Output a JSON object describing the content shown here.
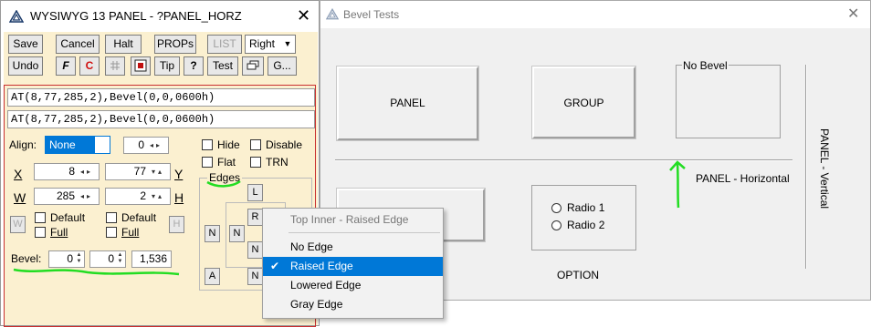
{
  "panel_window": {
    "title": "WYSIWYG 13 PANEL - ?PANEL_HORZ",
    "toolbar_row1": {
      "save": "Save",
      "cancel": "Cancel",
      "halt": "Halt",
      "props": "PROPs",
      "list": "LIST",
      "align_select": "Right"
    },
    "toolbar_row2": {
      "undo": "Undo",
      "font_btn": "F",
      "color_btn": "C",
      "tip": "Tip",
      "help": "?",
      "test": "Test",
      "more": "G..."
    },
    "code_lines": [
      "AT(8,77,285,2),Bevel(0,0,0600h)",
      "AT(8,77,285,2),Bevel(0,0,0600h)"
    ],
    "align_label": "Align:",
    "align_value": "None",
    "align_spin_value": "0",
    "x_label": "X",
    "x_value": "8",
    "y_label": "Y",
    "y_value": "77",
    "w_label": "W",
    "w_value": "285",
    "h_label": "H",
    "h_value": "2",
    "w_btn": "W",
    "h_btn": "H",
    "default_label": "Default",
    "full_label": "Full",
    "bevel_label": "Bevel:",
    "bevel_values": [
      "0",
      "0",
      "1,536"
    ],
    "hide_label": "Hide",
    "disable_label": "Disable",
    "flat_label": "Flat",
    "trn_label": "TRN",
    "edges_label": "Edges",
    "edge_buttons": {
      "top": "L",
      "inner_right": "R",
      "left_outer": "N",
      "left_inner": "N",
      "bottom_inner": "N",
      "bottom_a": "A",
      "bottom_n": "N"
    }
  },
  "bevel_window": {
    "title": "Bevel Tests",
    "panel_label": "PANEL",
    "group_label": "GROUP",
    "no_bevel_label": "No Bevel",
    "panel_horizontal_label": "PANEL - Horizontal",
    "panel_vertical_label": "PANEL - Vertical",
    "radio1": "Radio 1",
    "radio2": "Radio 2",
    "option_label": "OPTION"
  },
  "context_menu": {
    "header": "Top Inner - Raised Edge",
    "items": [
      "No Edge",
      "Raised Edge",
      "Lowered Edge",
      "Gray Edge"
    ],
    "selected_index": 1
  },
  "colors": {
    "accent": "#0078d7",
    "panel_bg": "#fbf0d0",
    "annotation": "#22dd22",
    "frame_red": "#c93030"
  }
}
